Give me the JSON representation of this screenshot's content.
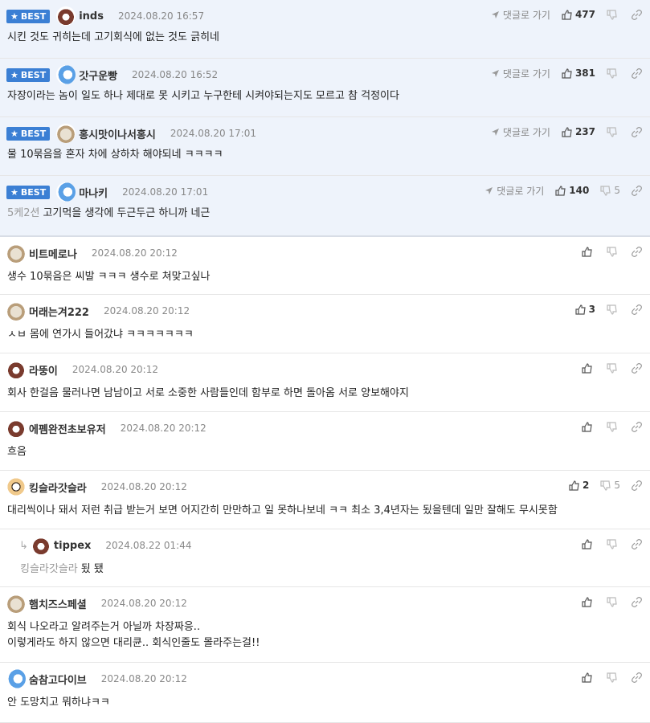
{
  "badge_label": "BEST",
  "goto_label": "댓글로 가기",
  "best_comments": [
    {
      "nick": "inds",
      "date": "2024.08.20 16:57",
      "likes": "477",
      "dislikes": "",
      "avatar": "bear",
      "text": "시킨 것도 귀히는데 고기회식에 없는 것도 긁히네",
      "ref": ""
    },
    {
      "nick": "갓구운빵",
      "date": "2024.08.20 16:52",
      "likes": "381",
      "dislikes": "",
      "avatar": "blue",
      "text": "자장이라는 놈이 일도 하나 제대로 못 시키고 누구한테 시켜야되는지도 모르고 참 걱정이다",
      "ref": ""
    },
    {
      "nick": "홍시맛이나서홍시",
      "date": "2024.08.20 17:01",
      "likes": "237",
      "dislikes": "",
      "avatar": "dog",
      "text": "물 10묶음을 혼자 차에 상하차 해야되네 ㅋㅋㅋㅋ",
      "ref": ""
    },
    {
      "nick": "마나키",
      "date": "2024.08.20 17:01",
      "likes": "140",
      "dislikes": "5",
      "avatar": "blue",
      "text": "고기먹을 생각에 두근두근 하니까 네근",
      "ref": "5케2션"
    }
  ],
  "comments": [
    {
      "nick": "비트메로나",
      "date": "2024.08.20 20:12",
      "likes": "",
      "dislikes": "",
      "avatar": "dog",
      "text": "생수 10묶음은 씨발 ㅋㅋㅋ 생수로 쳐맞고싶나",
      "ref": "",
      "reply": false
    },
    {
      "nick": "머래는겨222",
      "date": "2024.08.20 20:12",
      "likes": "3",
      "dislikes": "",
      "avatar": "dog",
      "text": "ㅅㅂ 몸에 연가시 들어갔냐 ㅋㅋㅋㅋㅋㅋㅋ",
      "ref": "",
      "reply": false
    },
    {
      "nick": "라뚱이",
      "date": "2024.08.20 20:12",
      "likes": "",
      "dislikes": "",
      "avatar": "bear",
      "text": "회사 한걸음 물러나면 남남이고 서로 소중한 사람들인데 함부로 하면 돌아옴 서로 양보해야지",
      "ref": "",
      "reply": false
    },
    {
      "nick": "에펨완전초보유저",
      "date": "2024.08.20 20:12",
      "likes": "",
      "dislikes": "",
      "avatar": "bear",
      "text": "흐음",
      "ref": "",
      "reply": false
    },
    {
      "nick": "킹슬라갓슬라",
      "date": "2024.08.20 20:12",
      "likes": "2",
      "dislikes": "5",
      "avatar": "fox",
      "text": "대리씩이나 돼서 저런 취급 받는거 보면 어지간히 만만하고 일 못하나보네 ㅋㅋ 최소 3,4년자는 됬을텐데 일만 잘해도 무시못함",
      "ref": "",
      "reply": false
    },
    {
      "nick": "tippex",
      "date": "2024.08.22 01:44",
      "likes": "",
      "dislikes": "",
      "avatar": "bear",
      "text": "됬 됐",
      "ref": "킹슬라갓슬라",
      "reply": true
    },
    {
      "nick": "햄치즈스페셜",
      "date": "2024.08.20 20:12",
      "likes": "",
      "dislikes": "",
      "avatar": "dog",
      "text": "회식 나오라고 알려주는거 아닐까 차장짜응..\n이렇게라도 하지 않으면 대리큔.. 회식인줄도 몰라주는걸!!",
      "ref": "",
      "reply": false
    },
    {
      "nick": "숨참고다이브",
      "date": "2024.08.20 20:12",
      "likes": "",
      "dislikes": "",
      "avatar": "blue",
      "text": "안 도망치고 뭐하냐ㅋㅋ",
      "ref": "",
      "reply": false
    }
  ]
}
